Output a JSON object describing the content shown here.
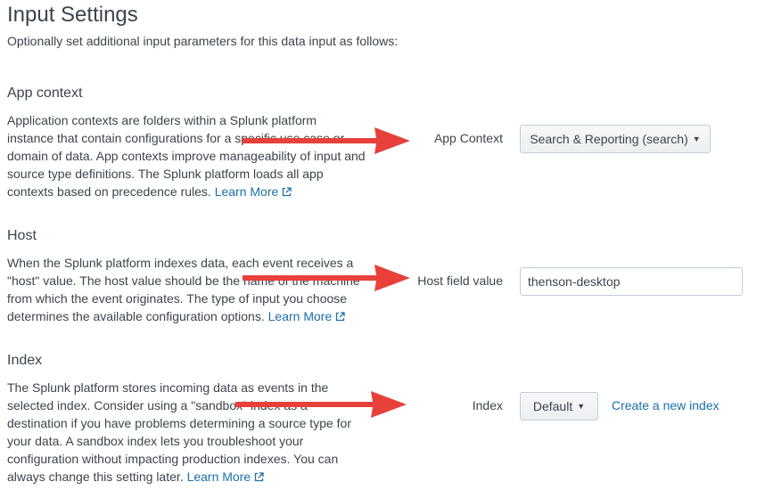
{
  "header": {
    "title": "Input Settings",
    "subtitle": "Optionally set additional input parameters for this data input as follows:"
  },
  "sections": {
    "app_context": {
      "heading": "App context",
      "description": "Application contexts are folders within a Splunk platform instance that contain configurations for a specific use case or domain of data. App contexts improve manageability of input and source type definitions. The Splunk platform loads all app contexts based on precedence rules.",
      "learn_more": "Learn More",
      "field_label": "App Context",
      "selected_value": "Search & Reporting (search)"
    },
    "host": {
      "heading": "Host",
      "description": "When the Splunk platform indexes data, each event receives a \"host\" value. The host value should be the name of the machine from which the event originates. The type of input you choose determines the available configuration options.",
      "learn_more": "Learn More",
      "field_label": "Host field value",
      "input_value": "thenson-desktop"
    },
    "index": {
      "heading": "Index",
      "description": "The Splunk platform stores incoming data as events in the selected index. Consider using a \"sandbox\" index as a destination if you have problems determining a source type for your data. A sandbox index lets you troubleshoot your configuration without impacting production indexes. You can always change this setting later.",
      "learn_more": "Learn More",
      "field_label": "Index",
      "selected_value": "Default",
      "create_link": "Create a new index"
    }
  },
  "icons": {
    "caret": "caret-down-icon",
    "external_link": "external-link-icon",
    "annotation_arrow": "arrow-right-icon"
  },
  "colors": {
    "text": "#3c444d",
    "link": "#1a6faa",
    "arrow": "#e8403a",
    "border": "#c3cbd4"
  }
}
